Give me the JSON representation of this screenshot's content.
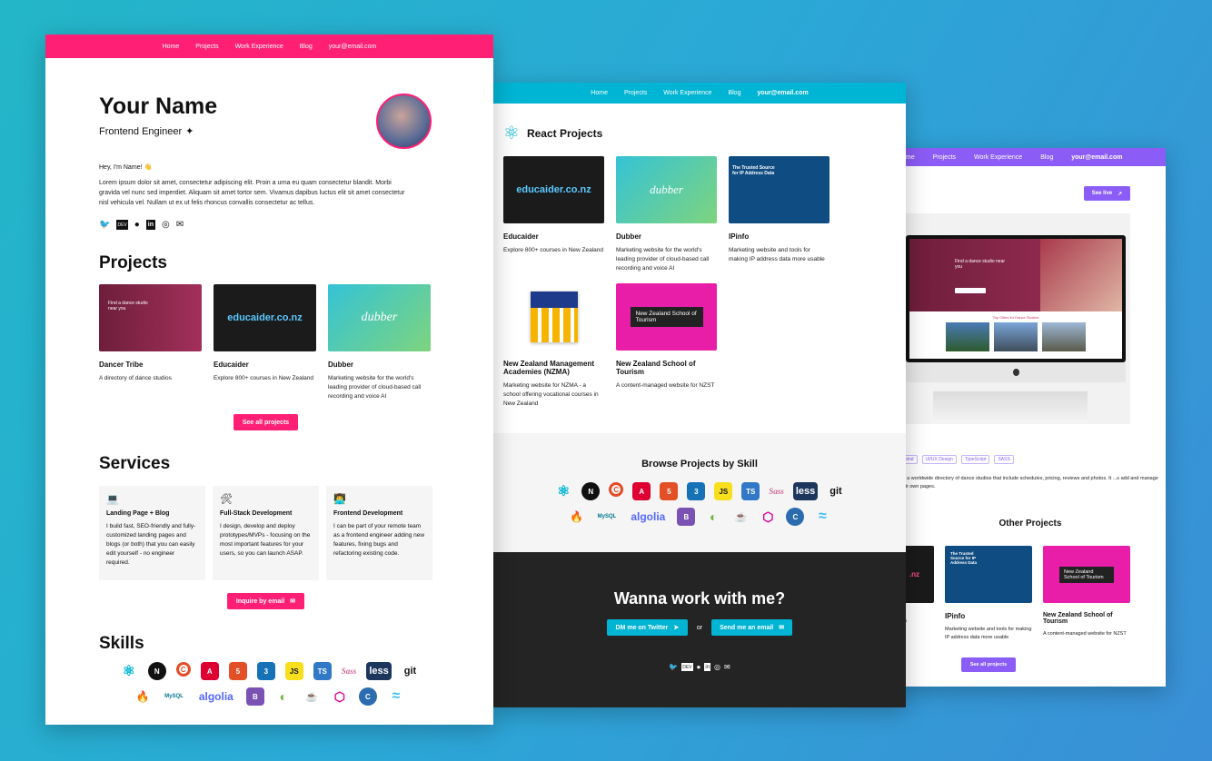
{
  "colors": {
    "pink": "#ff1f75",
    "cyan": "#00b5d3",
    "purple": "#8b5cf6",
    "dark": "#242424"
  },
  "nav": {
    "items": [
      "Home",
      "Projects",
      "Work Experience",
      "Blog"
    ],
    "email": "your@email.com"
  },
  "home": {
    "name": "Your Name",
    "role": "Frontend Engineer",
    "greeting": "Hey, I'm Name! 👋",
    "bio": "Lorem ipsum dolor sit amet, consectetur adipiscing elit. Proin a urna eu quam consectetur blandit. Morbi gravida vel nunc sed imperdiet. Aliquam sit amet tortor sem. Vivamus dapibus luctus elit sit amet consectetur nisl vehicula vel. Nullam ut ex ut felis rhoncus convallis consectetur ac tellus.",
    "social_dev": "DEV",
    "projects_heading": "Projects",
    "projects": [
      {
        "title": "Dancer Tribe",
        "desc": "A directory of dance studios"
      },
      {
        "title": "Educaider",
        "desc": "Explore 800+ courses in New Zealand"
      },
      {
        "title": "Dubber",
        "desc": "Marketing website for the world's leading provider of cloud-based call recording and voice AI"
      }
    ],
    "thumb_texts": {
      "educaider": "educaider.co.nz",
      "dubber": "dubber",
      "dance_heading": "Find a dance studio near you"
    },
    "see_all": "See all projects",
    "services_heading": "Services",
    "services": [
      {
        "emoji": "💻",
        "title": "Landing Page + Blog",
        "desc": "I build fast, SEO-friendly and fully-customized landing pages and blogs (or both) that you can easily edit yourself - no engineer required."
      },
      {
        "emoji": "🛠",
        "title": "Full-Stack Development",
        "desc": "I design, develop and deploy prototypes/MVPs - focusing on the most important features for your users, so you can launch ASAP."
      },
      {
        "emoji": "👨‍💻",
        "title": "Frontend Development",
        "desc": "I can be part of your remote team as a frontend engineer adding new features, fixing bugs and refactoring existing code."
      }
    ],
    "inquire": "Inquire by email",
    "skills_heading": "Skills"
  },
  "skills": {
    "row1": [
      "react",
      "next",
      "c",
      "angular",
      "html5",
      "css3",
      "js",
      "ts",
      "sass",
      "less",
      "git"
    ],
    "row2": [
      "firebase",
      "mysql",
      "algolia",
      "bootstrap",
      "spring",
      "java",
      "graphql",
      "cypress",
      "tailwind"
    ],
    "labels": {
      "js": "JS",
      "ts": "TS",
      "sass": "Sass",
      "less": "less",
      "git": "git",
      "mysql": "MySQL",
      "algolia": "algolia",
      "bootstrap": "B",
      "next": "N",
      "c": "C",
      "angular": "A",
      "html5": "5",
      "css3": "3"
    }
  },
  "projects_page": {
    "heading": "React Projects",
    "items": [
      {
        "title": "Educaider",
        "desc": "Explore 800+ courses in New Zealand"
      },
      {
        "title": "Dubber",
        "desc": "Marketing website for the world's leading provider of cloud-based call recording and voice AI"
      },
      {
        "title": "IPinfo",
        "desc": "Marketing website and tools for making IP address data more usable"
      },
      {
        "title": "New Zealand Management Academies (NZMA)",
        "desc": "Marketing website for NZMA - a school offering vocational courses in New Zealand"
      },
      {
        "title": "New Zealand School of Tourism",
        "desc": "A content-managed website for NZST"
      }
    ],
    "ipinfo_heading": "The Trusted Source for IP Address Data",
    "nzst_label": "New Zealand School of Tourism",
    "browse_heading": "Browse Projects by Skill",
    "cta_heading": "Wanna work with me?",
    "dm": "DM me on Twitter",
    "or": "or",
    "email_btn": "Send me an email"
  },
  "detail_page": {
    "see_live": "See live",
    "screen_heading": "Find a dance studio near you",
    "screen_sub": "Top Cities for Dance Studios",
    "tags": [
      "ilwind",
      "UI/UX Design",
      "TypeScript",
      "SASS"
    ],
    "desc": "...d a worldwide directory of dance studios that include schedules, pricing, reviews and photos. It ...s add and manage their own pages.",
    "other_heading": "Other Projects",
    "others": [
      {
        "title": "",
        "desc": "New"
      },
      {
        "title": "IPinfo",
        "desc": "Marketing website and tools for making IP address data more usable"
      },
      {
        "title": "New Zealand School of Tourism",
        "desc": "A content-managed website for NZST"
      }
    ],
    "see_all": "See all projects",
    "nav_first": "me"
  }
}
